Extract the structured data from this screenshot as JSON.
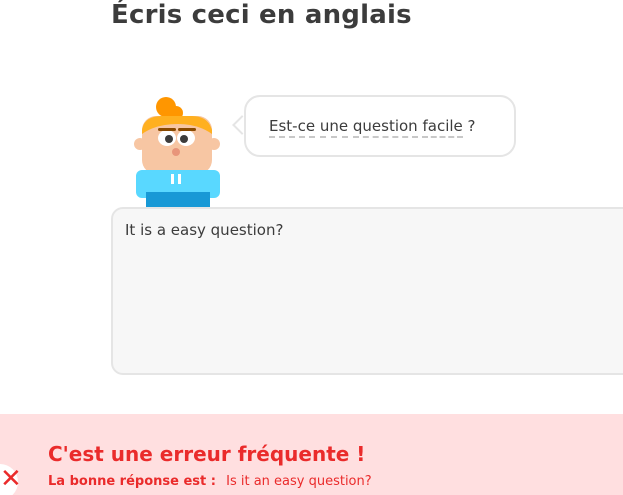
{
  "header": {
    "title": "Écris ceci en anglais"
  },
  "prompt": {
    "words": [
      "Est-ce",
      "une",
      "question",
      "facile"
    ],
    "punctuation": "?"
  },
  "answer_input": {
    "value": "It is a easy question?"
  },
  "feedback": {
    "title": "C'est une erreur fréquente !",
    "label": "La bonne réponse est :",
    "correct_answer": "Is it an easy question?"
  },
  "colors": {
    "error_red": "#ea2b2b",
    "feedback_bg": "#ffdfe0",
    "text_dark": "#3c3c3c",
    "border": "#e5e5e5"
  }
}
